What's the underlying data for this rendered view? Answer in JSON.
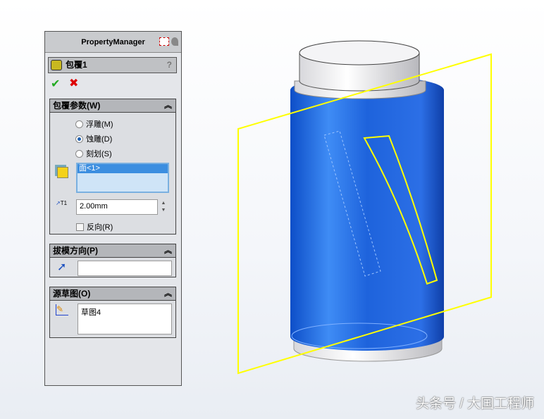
{
  "property_manager": {
    "title": "PropertyManager",
    "feature_name": "包覆1",
    "help": "?",
    "ok": "✔",
    "cancel": "✖",
    "group_wrap": {
      "title": "包覆参数(W)",
      "collapse": "︽",
      "options": [
        {
          "label": "浮雕(M)",
          "selected": false
        },
        {
          "label": "蚀雕(D)",
          "selected": true
        },
        {
          "label": "刻划(S)",
          "selected": false
        }
      ],
      "faces": "面<1>",
      "thickness": "2.00mm",
      "thickness_label": "T1",
      "reverse": "反向(R)"
    },
    "group_draft": {
      "title": "拔模方向(P)",
      "collapse": "︽",
      "value": ""
    },
    "group_sketch": {
      "title": "源草图(O)",
      "collapse": "︽",
      "value": "草图4"
    }
  },
  "watermark": "头条号 / 大国工程师",
  "colors": {
    "body": "#2a6fe0",
    "plane": "#ffff00"
  }
}
